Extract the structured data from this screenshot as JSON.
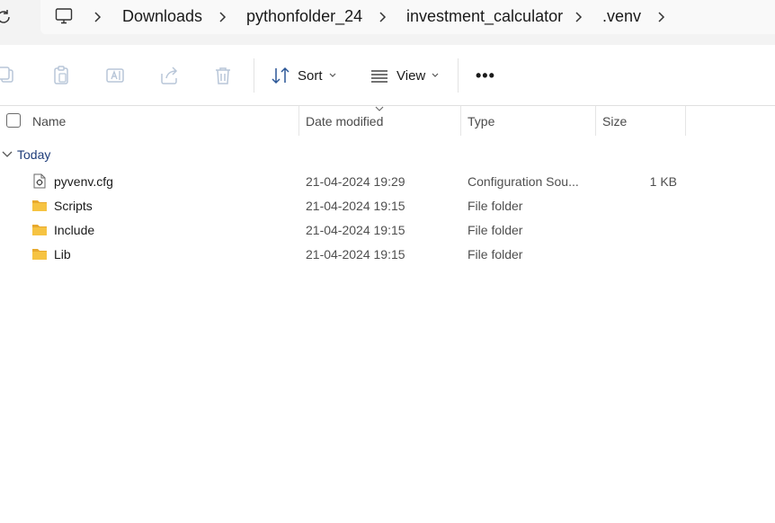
{
  "address_bar": {
    "crumbs": [
      "Downloads",
      "pythonfolder_24",
      "investment_calculator",
      ".venv"
    ]
  },
  "command_bar": {
    "sort_label": "Sort",
    "view_label": "View",
    "more_label": "•••"
  },
  "columns": {
    "name": "Name",
    "date_modified": "Date modified",
    "type": "Type",
    "size": "Size"
  },
  "group": {
    "label": "Today"
  },
  "files": [
    {
      "name": "pyvenv.cfg",
      "date": "21-04-2024 19:29",
      "type": "Configuration Sou...",
      "size": "1 KB",
      "icon": "config-file-icon"
    },
    {
      "name": "Scripts",
      "date": "21-04-2024 19:15",
      "type": "File folder",
      "size": "",
      "icon": "folder-icon"
    },
    {
      "name": "Include",
      "date": "21-04-2024 19:15",
      "type": "File folder",
      "size": "",
      "icon": "folder-icon"
    },
    {
      "name": "Lib",
      "date": "21-04-2024 19:15",
      "type": "File folder",
      "size": "",
      "icon": "folder-icon"
    }
  ],
  "colors": {
    "folder": "#f6c342",
    "group_text": "#1f3d7a"
  }
}
